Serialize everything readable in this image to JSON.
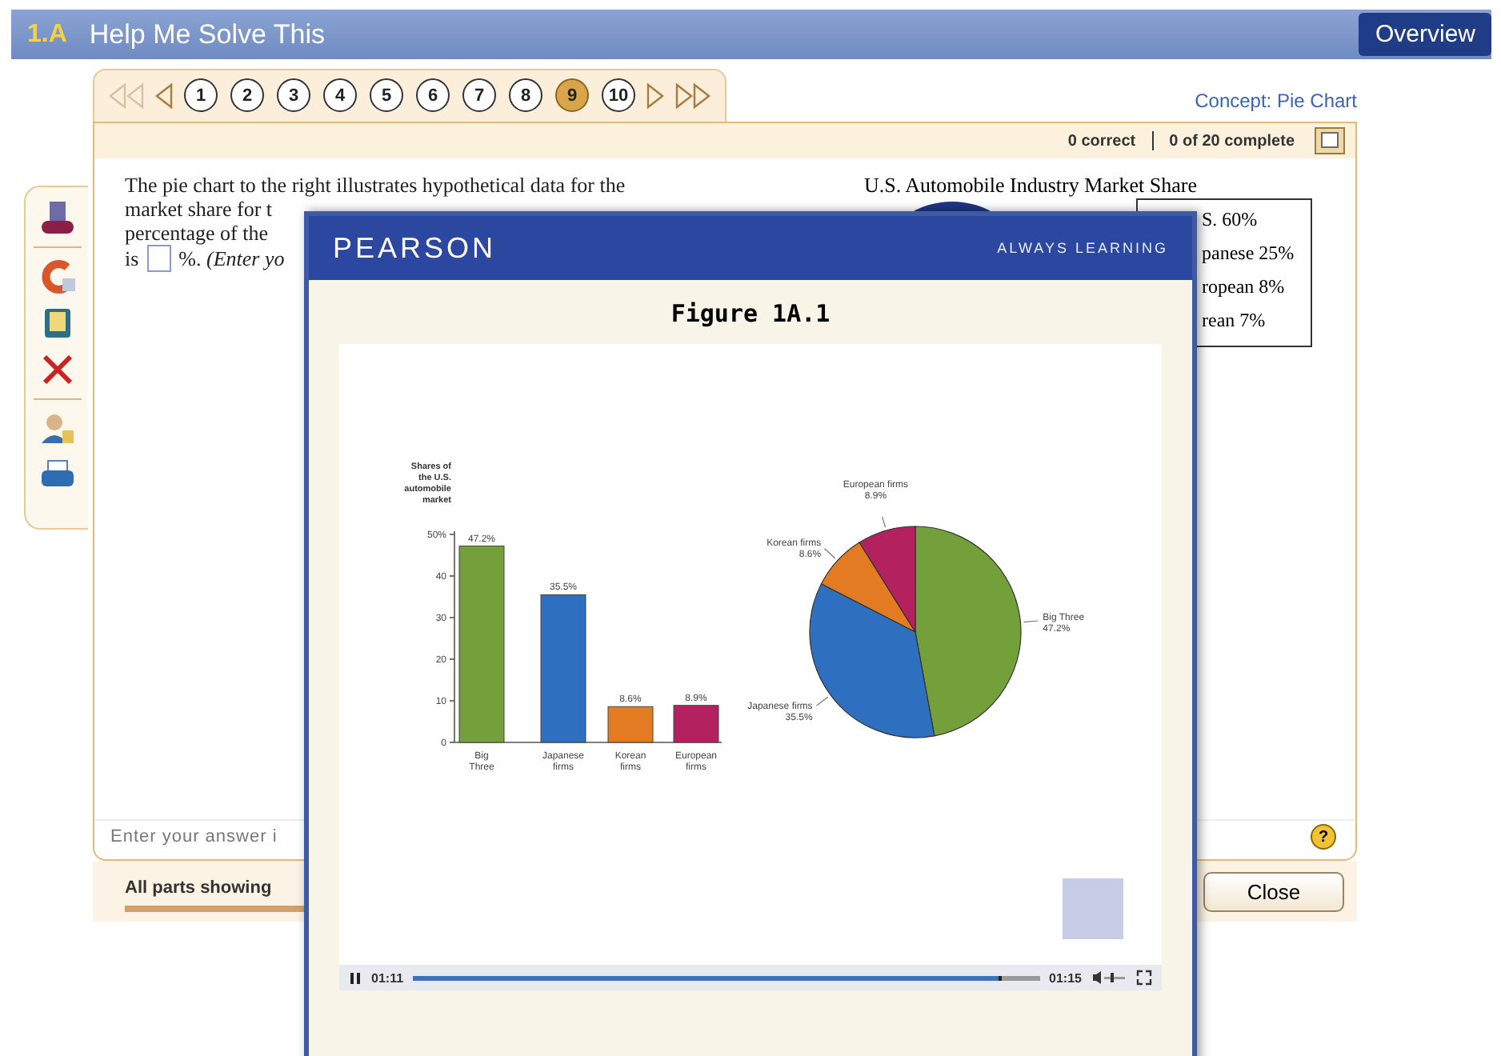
{
  "header": {
    "section": "1.A",
    "title": "Help Me Solve This",
    "overview_button": "Overview"
  },
  "nav": {
    "arrows_left": [
      {
        "kind": "first",
        "disabled": true
      },
      {
        "kind": "prev",
        "disabled": false
      }
    ],
    "questions": [
      {
        "label": "1",
        "selected": false
      },
      {
        "label": "2",
        "selected": false
      },
      {
        "label": "3",
        "selected": false
      },
      {
        "label": "4",
        "selected": false
      },
      {
        "label": "5",
        "selected": false
      },
      {
        "label": "6",
        "selected": false
      },
      {
        "label": "7",
        "selected": false
      },
      {
        "label": "8",
        "selected": false
      },
      {
        "label": "9",
        "selected": true
      },
      {
        "label": "10",
        "selected": false
      }
    ],
    "arrows_right": [
      {
        "kind": "next",
        "disabled": false
      },
      {
        "kind": "last",
        "disabled": false
      }
    ]
  },
  "concept_link": "Concept: Pie Chart",
  "score": {
    "correct": "0 correct",
    "complete": "0 of 20 complete"
  },
  "question": {
    "lines": [
      "The pie chart to the right illustrates hypothetical data for the",
      "market share for t",
      "percentage of the"
    ],
    "answer_prefix": "is",
    "answer_suffix": "%. *(Enter yo*"
  },
  "pie_panel": {
    "title": "U.S. Automobile Industry Market Share",
    "legend": [
      "S. 60%",
      "panese 25%",
      "ropean 8%",
      "rean 7%"
    ]
  },
  "answer_hint": "Enter your answer i",
  "help": "?",
  "footer": {
    "parts": "All parts showing",
    "progress": {
      "level": 1
    },
    "close_button": "Close"
  },
  "modal": {
    "brand": "PEARSON",
    "tagline": "ALWAYS LEARNING",
    "figure_title": "Figure 1A.1",
    "charts": [
      {
        "chart_data": {
          "type": "bar",
          "ylabel": "Shares of the U.S. automobile market",
          "categories": [
            "Big Three",
            "Japanese firms",
            "Korean firms",
            "European firms"
          ],
          "values": [
            47.2,
            35.5,
            8.6,
            8.9
          ],
          "colors": [
            "#74a03c",
            "#2e6fc0",
            "#e27b22",
            "#b3215f"
          ],
          "ylim": [
            0,
            50
          ],
          "yticks": [
            0,
            10,
            20,
            30,
            40,
            {
              "value": 50,
              "label": "50%"
            }
          ],
          "value_labels": [
            "47.2%",
            "35.5%",
            "8.6%",
            "8.9%"
          ]
        }
      },
      {
        "chart_data": {
          "type": "pie",
          "categories": [
            "Big Three",
            "Japanese firms",
            "Korean firms",
            "European firms"
          ],
          "values": [
            47.2,
            35.5,
            8.6,
            8.9
          ],
          "colors": [
            "#74a03c",
            "#2e6fc0",
            "#e27b22",
            "#b3215f"
          ],
          "value_labels": [
            "47.2%",
            "35.5%",
            "8.6%",
            "8.9%"
          ]
        }
      }
    ],
    "player": {
      "elapsed": "01:11",
      "duration": "01:15",
      "level": 0.94
    }
  }
}
